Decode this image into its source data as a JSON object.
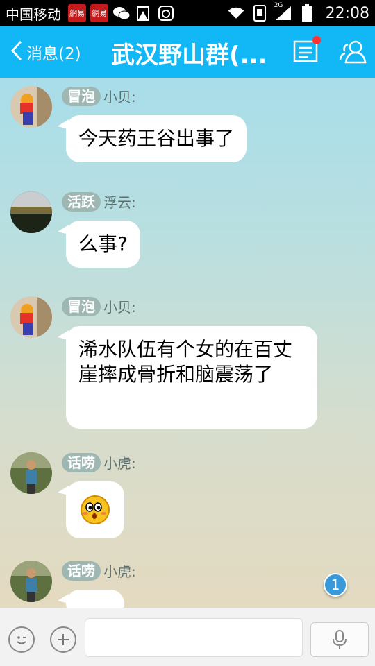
{
  "status_bar": {
    "carrier": "中国移动",
    "app_badge_1": "網易",
    "app_badge_2": "網易",
    "signal_label": "2G",
    "time": "22:08"
  },
  "header": {
    "back_label": "消息(2)",
    "title": "武汉野山群(...",
    "accent_color": "#12b7f5"
  },
  "messages": [
    {
      "rank": "冒泡",
      "sender": "小贝:",
      "text": "今天药王谷出事了"
    },
    {
      "rank": "活跃",
      "sender": "浮云:",
      "text": "么事?"
    },
    {
      "rank": "冒泡",
      "sender": "小贝:",
      "text": "浠水队伍有个女的在百丈崖摔成骨折和脑震荡了"
    },
    {
      "rank": "话唠",
      "sender": "小虎:",
      "text": "",
      "emoji": "surprised-face"
    },
    {
      "rank": "话唠",
      "sender": "小虎:",
      "text": ""
    }
  ],
  "unread_count": "1",
  "input": {
    "placeholder": ""
  }
}
